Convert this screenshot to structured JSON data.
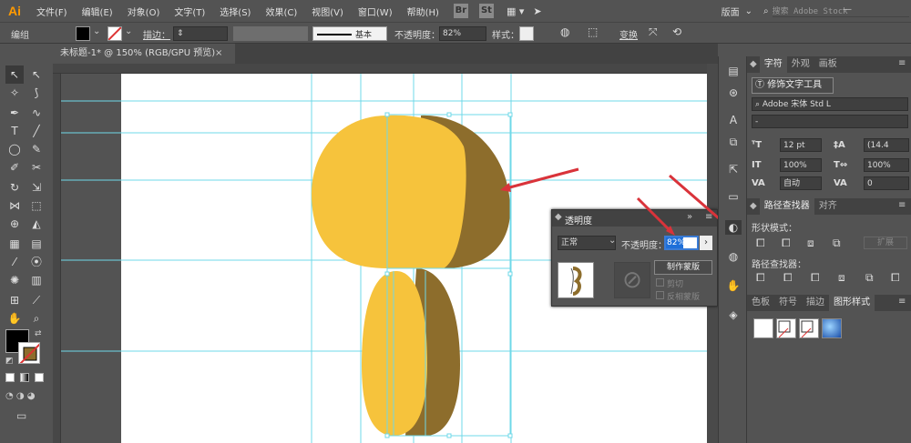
{
  "app": {
    "logo": "Ai"
  },
  "menu": [
    "文件(F)",
    "编辑(E)",
    "对象(O)",
    "文字(T)",
    "选择(S)",
    "效果(C)",
    "视图(V)",
    "窗口(W)",
    "帮助(H)"
  ],
  "menu_right": {
    "bridge": "Br",
    "stock": "St",
    "workspace": "版面",
    "search_placeholder": "搜索 Adobe Stock"
  },
  "control_bar": {
    "selection": "编组",
    "stroke_label": "描边：",
    "stroke_style": "基本",
    "opacity_label": "不透明度：",
    "opacity_value": "82%",
    "style_label": "样式：",
    "transform": "变换"
  },
  "document": {
    "tab_title": "未标题-1* @ 150% (RGB/GPU 预览)",
    "close": "×"
  },
  "colors": {
    "fill_front": "#f6c33c",
    "fill_side": "#8d6d2c",
    "guide": "#6fd8e8",
    "arrow": "#d9333a"
  },
  "transparency_panel": {
    "title": "透明度",
    "blend_mode": "正常",
    "opacity_label": "不透明度：",
    "opacity_value": "82%",
    "make_mask": "制作蒙版",
    "clip": "剪切",
    "invert_mask": "反相蒙版"
  },
  "character_panel": {
    "tabs": [
      "字符",
      "外观",
      "画板"
    ],
    "touch_type": "修饰文字工具",
    "font_family": "Adobe 宋体 Std L",
    "font_style": "-",
    "font_size": "12 pt",
    "leading": "(14.4 ",
    "vscale": "100%",
    "hscale": "100%",
    "kerning": "自动",
    "tracking": "0"
  },
  "pathfinder_panel": {
    "tabs": [
      "路径查找器",
      "对齐"
    ],
    "shape_modes": "形状模式：",
    "expand": "扩展",
    "pathfinders": "路径查找器："
  },
  "graphic_styles_panel": {
    "tabs": [
      "色板",
      "符号",
      "描边",
      "图形样式"
    ]
  }
}
